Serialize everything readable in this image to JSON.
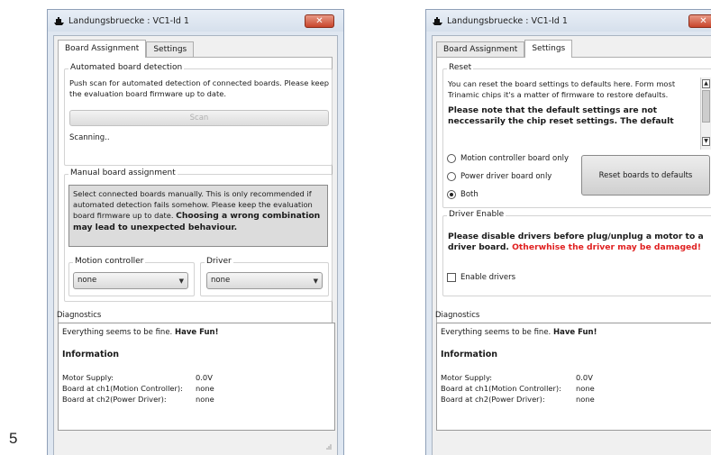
{
  "figure_number": "5",
  "colors": {
    "close_button": "#c8452b",
    "warning_text": "#e02020",
    "window_frame": "#dfe7f1"
  },
  "left_window": {
    "title": "Landungsbruecke : VC1-Id 1",
    "icon": "ship-icon",
    "close_icon": "close-icon",
    "tabs": [
      {
        "label": "Board Assignment",
        "selected": true
      },
      {
        "label": "Settings",
        "selected": false
      }
    ],
    "auto_detection": {
      "legend": "Automated board detection",
      "description": "Push scan for automated detection of connected boards. Please keep the evaluation board firmware up to date.",
      "scan_label": "Scan",
      "status": "Scanning.."
    },
    "manual_assignment": {
      "legend": "Manual board assignment",
      "info_plain": "Select connected boards manually. This is only recommended if automated detection fails somehow. Please keep the evaluation board firmware up to date. ",
      "info_bold": "Choosing a wrong combination may lead to unexpected behaviour.",
      "motion_controller": {
        "legend": "Motion controller",
        "value": "none"
      },
      "driver": {
        "legend": "Driver",
        "value": "none"
      }
    },
    "diagnostics": {
      "legend": "Diagnostics",
      "status_plain": "Everything seems to be fine. ",
      "status_bold": "Have Fun!",
      "info_heading": "Information",
      "rows": [
        {
          "key": "Motor Supply:",
          "value": "0.0V"
        },
        {
          "key": "Board at ch1(Motion Controller):",
          "value": "none"
        },
        {
          "key": "Board at ch2(Power Driver):",
          "value": "none"
        }
      ]
    }
  },
  "right_window": {
    "title": "Landungsbruecke : VC1-Id 1",
    "tabs": [
      {
        "label": "Board Assignment",
        "selected": false
      },
      {
        "label": "Settings",
        "selected": true
      }
    ],
    "reset": {
      "legend": "Reset",
      "text_plain": "You can reset the board settings to defaults here. Form most Trinamic chips it's a matter of firmware to restore defaults.",
      "text_bold": "Please note that the default settings are not neccessarily the chip reset settings. The default",
      "options": [
        {
          "label": "Motion controller board only",
          "checked": false
        },
        {
          "label": "Power driver board only",
          "checked": false
        },
        {
          "label": "Both",
          "checked": true
        }
      ],
      "button_label": "Reset boards to defaults"
    },
    "driver_enable": {
      "legend": "Driver Enable",
      "note_bold": "Please disable drivers before plug/unplug a motor to a driver board. ",
      "note_warning": "Otherwhise the driver may be damaged!",
      "checkbox_label": "Enable drivers",
      "checked": false
    },
    "diagnostics": {
      "legend": "Diagnostics",
      "status_plain": "Everything seems to be fine. ",
      "status_bold": "Have Fun!",
      "info_heading": "Information",
      "rows": [
        {
          "key": "Motor Supply:",
          "value": "0.0V"
        },
        {
          "key": "Board at ch1(Motion Controller):",
          "value": "none"
        },
        {
          "key": "Board at ch2(Power Driver):",
          "value": "none"
        }
      ]
    }
  }
}
